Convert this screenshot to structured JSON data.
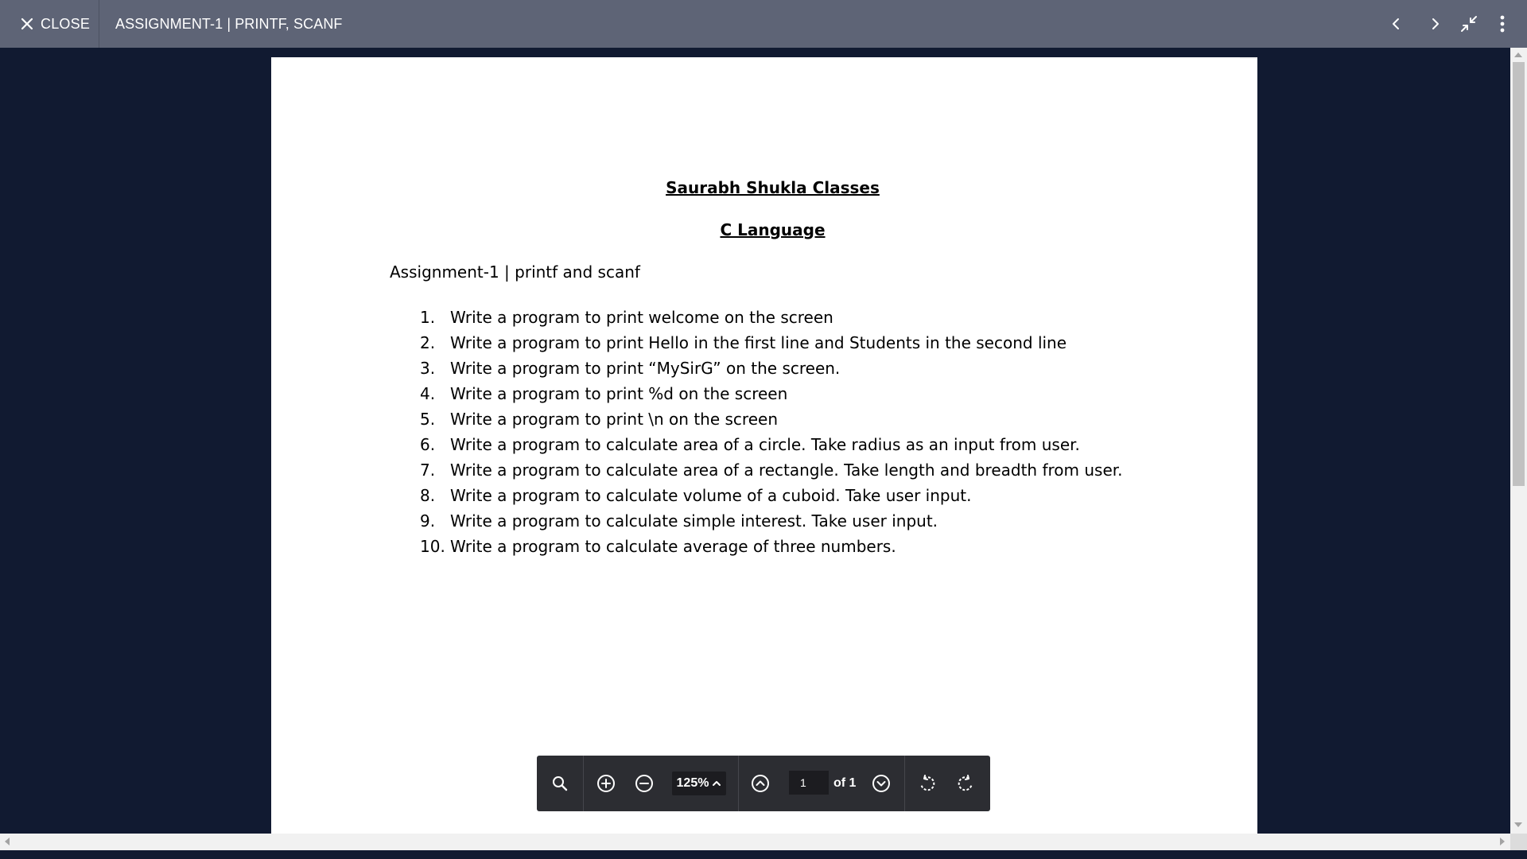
{
  "topbar": {
    "close_label": "CLOSE",
    "document_title": "ASSIGNMENT-1 | PRINTF, SCANF",
    "icons": [
      "close-icon",
      "chevron-left-icon",
      "chevron-right-icon",
      "exit-fullscreen-icon",
      "more-vertical-icon"
    ]
  },
  "document": {
    "heading": "Saurabh Shukla Classes",
    "subheading": "C Language",
    "title": "Assignment-1 | printf and scanf",
    "tasks": [
      {
        "num": "1.",
        "text": "Write a program to print welcome on the screen"
      },
      {
        "num": "2.",
        "text": "Write a program to print Hello in the first line and Students in the second line"
      },
      {
        "num": "3.",
        "text": "Write a program to print “MySirG” on the screen."
      },
      {
        "num": "4.",
        "text": "Write a program to print %d on the screen"
      },
      {
        "num": "5.",
        "text": "Write a program to print \\n on the screen"
      },
      {
        "num": "6.",
        "text": "Write a program to calculate area of a circle. Take radius as an input from user."
      },
      {
        "num": "7.",
        "text": "Write a program to calculate area of a rectangle. Take length and breadth from user."
      },
      {
        "num": "8.",
        "text": "Write a program to calculate volume of a cuboid. Take user input."
      },
      {
        "num": "9.",
        "text": "Write a program to calculate simple interest. Take user input."
      },
      {
        "num": "10.",
        "text": "Write a program to calculate average of three numbers."
      }
    ]
  },
  "toolbar": {
    "zoom_level": "125%",
    "current_page": "1",
    "page_total": "of 1",
    "icons": [
      "search-icon",
      "zoom-in-icon",
      "zoom-out-icon",
      "chevron-up-icon",
      "page-up-icon",
      "page-down-icon",
      "rotate-left-icon",
      "rotate-right-icon"
    ]
  },
  "colors": {
    "topbar": "#5e6476",
    "viewer_background": "#111a31",
    "toolbar": "#2c2d32",
    "page": "#ffffff"
  }
}
